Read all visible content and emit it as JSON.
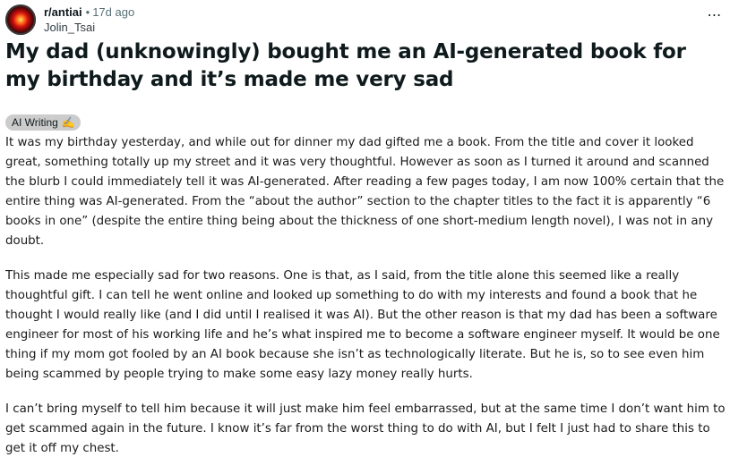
{
  "post": {
    "subreddit": "r/antiai",
    "separator": "•",
    "time_ago": "17d ago",
    "author": "Jolin_Tsai",
    "more_icon": "⋯",
    "title": "My dad (unknowingly) bought me an AI-generated book for my birthday and it’s made me very sad",
    "flair": {
      "text": "AI Writing",
      "emoji": "✍️"
    },
    "body": [
      "It was my birthday yesterday, and while out for dinner my dad gifted me a book. From the title and cover it looked great, something totally up my street and it was very thoughtful. However as soon as I turned it around and scanned the blurb I could immediately tell it was AI-generated. After reading a few pages today, I am now 100% certain that the entire thing was AI-generated. From the “about the author” section to the chapter titles to the fact it is apparently “6 books in one” (despite the entire thing being about the thickness of one short-medium length novel), I was not in any doubt.",
      "This made me especially sad for two reasons. One is that, as I said, from the title alone this seemed like a really thoughtful gift. I can tell he went online and looked up something to do with my interests and found a book that he thought I would really like (and I did until I realised it was AI). But the other reason is that my dad has been a software engineer for most of his working life and he’s what inspired me to become a software engineer myself. It would be one thing if my mom got fooled by an AI book because she isn’t as technologically literate. But he is, so to see even him being scammed by people trying to make some easy lazy money really hurts.",
      "I can’t bring myself to tell him because it will just make him feel embarrassed, but at the same time I don’t want him to get scammed again in the future. I know it’s far from the worst thing to do with AI, but I felt I just had to share this to get it off my chest."
    ]
  }
}
